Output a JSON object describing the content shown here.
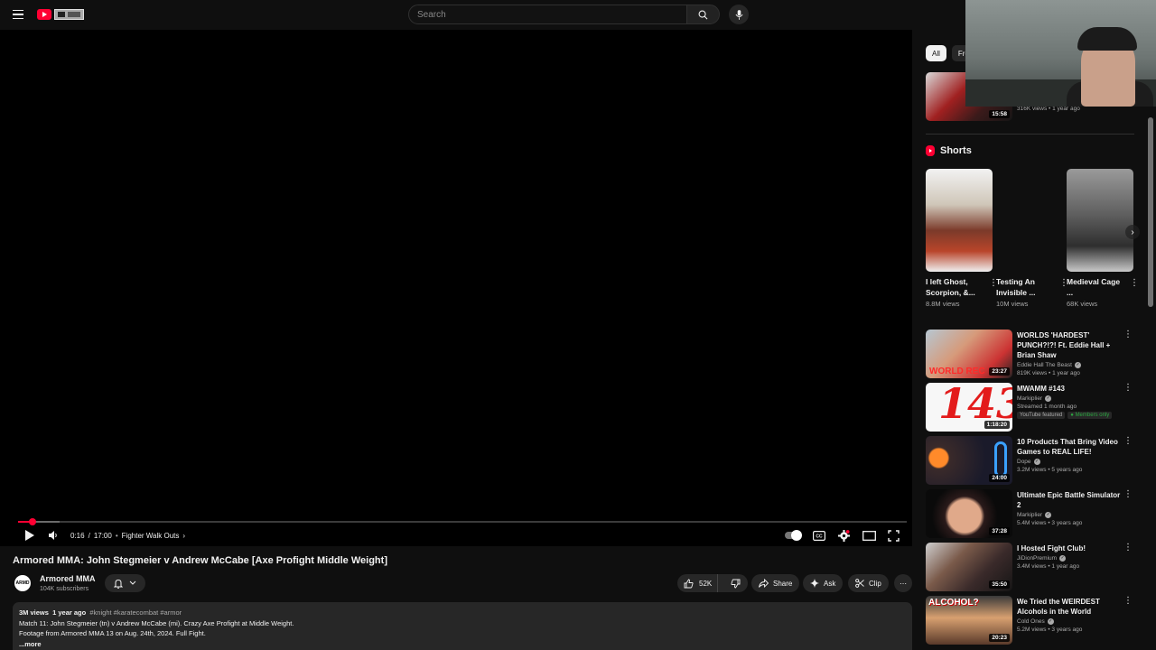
{
  "header": {
    "search_placeholder": "Search"
  },
  "player": {
    "time_current": "0:16",
    "time_separator": "/",
    "time_total": "17:00",
    "chapter": "Fighter Walk Outs",
    "progress_fraction": 0.016,
    "buffer_fraction": 0.047
  },
  "video": {
    "title": "Armored MMA: John Stegmeier v Andrew McCabe [Axe Profight Middle Weight]",
    "channel_avatar_text": "ARMD",
    "channel_name": "Armored MMA",
    "subscribers": "104K subscribers",
    "likes": "52K",
    "share_label": "Share",
    "ask_label": "Ask",
    "clip_label": "Clip"
  },
  "description": {
    "views": "3M views",
    "age": "1 year ago",
    "tags": "#knight #karatecombat #armor",
    "line1": "Match 11: John Stegmeier (tn) v Andrew McCabe (mi). Crazy Axe Profight at Middle Weight.",
    "line2": "Footage from Armored MMA 13 on Aug. 24th, 2024. Full Fight.",
    "more": "...more"
  },
  "sidebar": {
    "chips": [
      "All",
      "Fro"
    ],
    "top_item": {
      "duration": "15:58",
      "meta": "316K views • 1 year ago"
    },
    "shorts_title": "Shorts",
    "shorts": [
      {
        "title": "I left Ghost, Scorpion, &...",
        "views": "8.8M views"
      },
      {
        "title": "Testing An Invisible ...",
        "views": "10M views"
      },
      {
        "title": "Medieval Cage ...",
        "views": "68K views"
      }
    ],
    "recommendations": [
      {
        "title": "WORLDS 'HARDEST' PUNCH?!?! Ft. Eddie Hall + Brian Shaw",
        "channel": "Eddie Hall The Beast",
        "meta": "819K views • 1 year ago",
        "duration": "23:27",
        "thumb_text": "WORLD REC"
      },
      {
        "title": "MWAMM #143",
        "channel": "Markiplier",
        "meta": "Streamed 1 month ago",
        "duration": "1:18:20",
        "thumb_text": "143",
        "badge1": "YouTube featured",
        "badge2": "Members only"
      },
      {
        "title": "10 Products That Bring Video Games to REAL LIFE!",
        "channel": "Dope",
        "meta": "3.2M views • 5 years ago",
        "duration": "24:00"
      },
      {
        "title": "Ultimate Epic Battle Simulator 2",
        "channel": "Markiplier",
        "meta": "5.4M views • 3 years ago",
        "duration": "37:28"
      },
      {
        "title": "I Hosted Fight Club!",
        "channel": "JiDionPremium",
        "meta": "3.4M views • 1 year ago",
        "duration": "35:50"
      },
      {
        "title": "We Tried the WEIRDEST Alcohols in the World",
        "channel": "Cold Ones",
        "meta": "5.2M views • 3 years ago",
        "duration": "20:23",
        "thumb_text": "ALCOHOL?"
      }
    ]
  }
}
